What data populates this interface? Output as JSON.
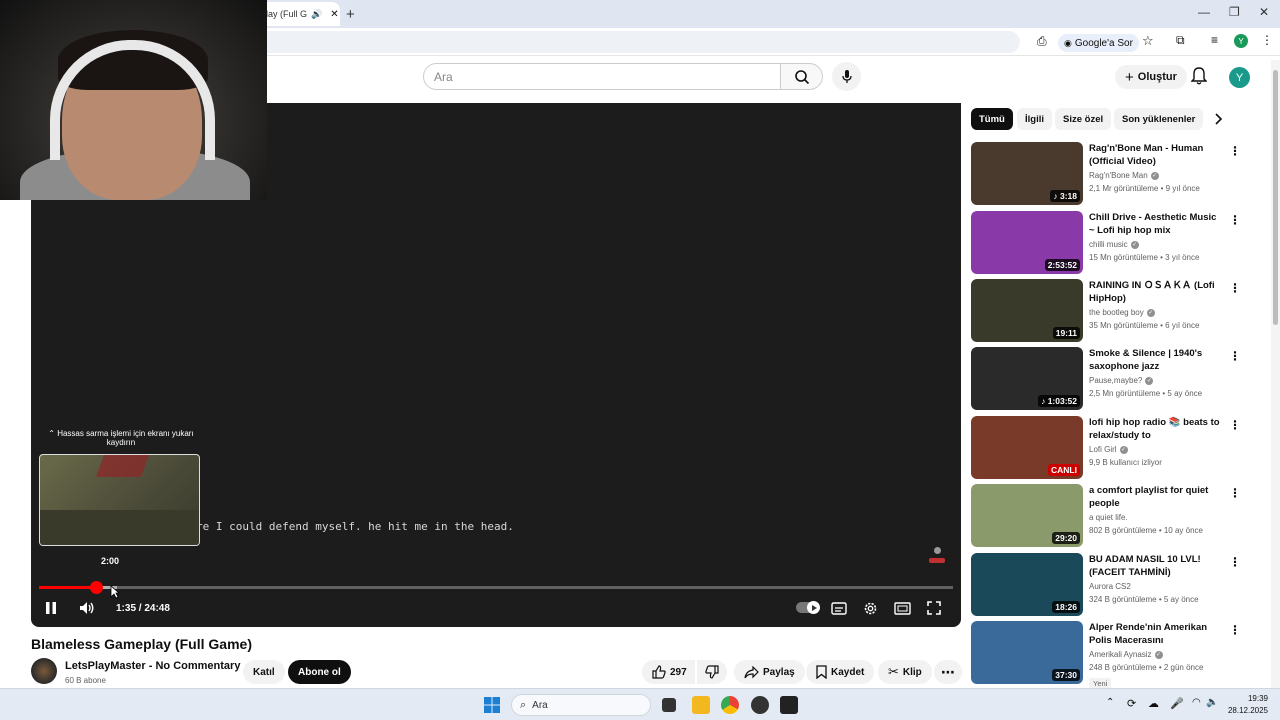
{
  "browser": {
    "tab_title": "lay (Full G",
    "new_tab": "+",
    "ask_google": "Google'a Sor",
    "profile_initial": "Y"
  },
  "header": {
    "search_placeholder": "Ara",
    "create_label": "Oluştur",
    "avatar_initial": "Y"
  },
  "player": {
    "subtitle": "re I could defend myself. he hit me in the head.",
    "scrub_hint": "⌃ Hassas sarma işlemi için ekranı yukarı kaydırın",
    "preview_time": "2:00",
    "time_display": "1:35 / 24:48",
    "played_fraction": 0.064,
    "buffered_fraction": 0.085
  },
  "video": {
    "title": "Blameless Gameplay (Full Game)",
    "channel": "LetsPlayMaster - No Commentary",
    "subscribers": "60 B abone",
    "join_label": "Katıl",
    "subscribe_label": "Abone ol",
    "likes": "297",
    "share_label": "Paylaş",
    "save_label": "Kaydet",
    "clip_label": "Klip"
  },
  "chips": [
    "Tümü",
    "İlgili",
    "Size özel",
    "Son yüklenenler"
  ],
  "recommendations": [
    {
      "title": "Rag'n'Bone Man - Human (Official Video)",
      "channel": "Rag'n'Bone Man",
      "meta": "2,1 Mr görüntüleme • 9 yıl önce",
      "duration": "♪ 3:18",
      "thumb": "#4a3a2e",
      "verified": true,
      "badge": ""
    },
    {
      "title": "Chill Drive - Aesthetic Music ~ Lofi hip hop mix",
      "channel": "chilli music",
      "meta": "15 Mn görüntüleme • 3 yıl önce",
      "duration": "2:53:52",
      "thumb": "#8a3aa8",
      "verified": true,
      "badge": ""
    },
    {
      "title": "RAINING IN ＯＳＡＫＡ (Lofi HipHop)",
      "channel": "the bootleg boy",
      "meta": "35 Mn görüntüleme • 6 yıl önce",
      "duration": "19:11",
      "thumb": "#3a3a2a",
      "verified": true,
      "badge": ""
    },
    {
      "title": "Smoke & Silence | 1940's saxophone jazz",
      "channel": "Pause,maybe?",
      "meta": "2,5 Mn görüntüleme • 5 ay önce",
      "duration": "♪ 1:03:52",
      "thumb": "#2a2a2a",
      "verified": true,
      "badge": ""
    },
    {
      "title": "lofi hip hop radio 📚 beats to relax/study to",
      "channel": "Lofi Girl",
      "meta": "9,9 B kullanıcı izliyor",
      "duration": "CANLI",
      "thumb": "#7a3a2a",
      "verified": true,
      "badge": ""
    },
    {
      "title": "a comfort playlist for quiet people",
      "channel": "a quiet life.",
      "meta": "802 B görüntüleme • 10 ay önce",
      "duration": "29:20",
      "thumb": "#8a9a6a",
      "verified": false,
      "badge": ""
    },
    {
      "title": "BU ADAM NASIL 10 LVL! (FACEIT TAHMİNİ)",
      "channel": "Aurora CS2",
      "meta": "324 B görüntüleme • 5 ay önce",
      "duration": "18:26",
      "thumb": "#1a4a5a",
      "verified": false,
      "badge": ""
    },
    {
      "title": "Alper Rende'nin Amerikan Polis Macerasını Yorumluyorum! ...",
      "channel": "Amerikali Aynasiz",
      "meta": "248 B görüntüleme • 2 gün önce",
      "duration": "37:30",
      "thumb": "#3a6a9a",
      "verified": true,
      "badge": "Yeni"
    }
  ],
  "taskbar": {
    "search_label": "Ara",
    "time": "19:39",
    "date": "28.12.2025"
  }
}
